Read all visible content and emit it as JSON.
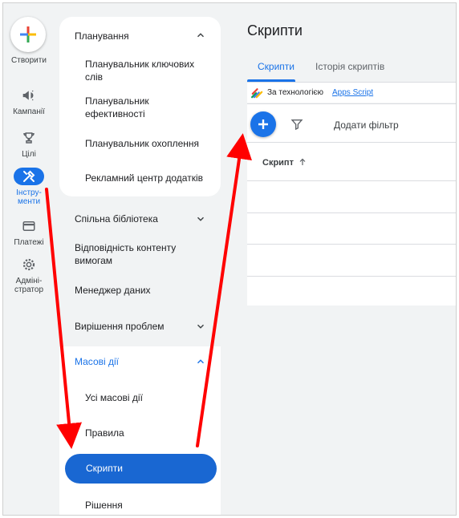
{
  "rail": {
    "create_label": "Створити",
    "items": [
      {
        "label": "Кампанії",
        "icon": "megaphone-icon"
      },
      {
        "label": "Цілі",
        "icon": "trophy-icon"
      },
      {
        "label": "Інстру-\nменти",
        "icon": "tools-icon",
        "active": true
      },
      {
        "label": "Платежі",
        "icon": "credit-card-icon"
      },
      {
        "label": "Адміні-\nстратор",
        "icon": "gear-icon"
      }
    ]
  },
  "nav": {
    "planning": "Планування",
    "keyword_planner": "Планувальник ключових слів",
    "performance_planner": "Планувальник ефективності",
    "reach_planner": "Планувальник охоплення",
    "app_ad_hub": "Рекламний центр додатків",
    "shared_library": "Спільна бібліотека",
    "content_suitability": "Відповідність контенту вимогам",
    "data_manager": "Менеджер даних",
    "troubleshooting": "Вирішення проблем",
    "bulk_actions": "Масові дії",
    "all_bulk_actions": "Усі масові дії",
    "rules": "Правила",
    "scripts": "Скрипти",
    "solutions": "Рішення"
  },
  "main": {
    "title": "Скрипти",
    "tabs": [
      "Скрипти",
      "Історія скриптів"
    ],
    "powered_by": "За технологією",
    "powered_link": "Apps Script",
    "add_filter": "Додати фільтр",
    "column_header": "Скрипт"
  },
  "colors": {
    "accent": "#1a73e8",
    "arrow": "#ff0000"
  }
}
